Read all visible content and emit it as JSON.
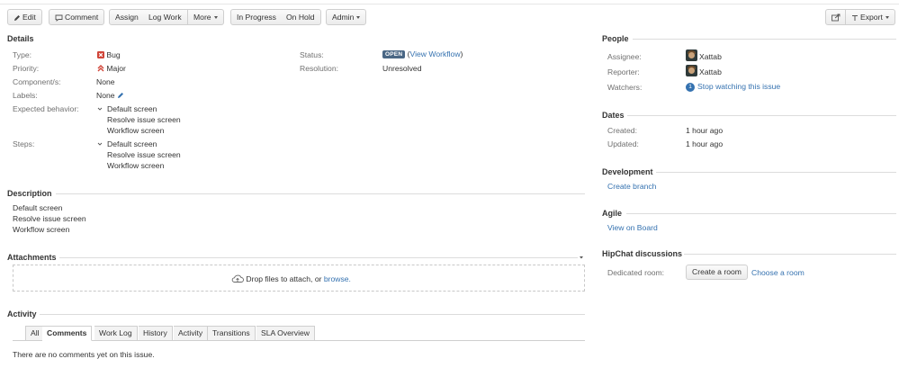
{
  "toolbar": {
    "edit": "Edit",
    "comment": "Comment",
    "assign": "Assign",
    "log_work": "Log Work",
    "more": "More",
    "in_progress": "In Progress",
    "on_hold": "On Hold",
    "admin": "Admin",
    "export": "Export"
  },
  "details": {
    "heading": "Details",
    "type_label": "Type:",
    "type_value": "Bug",
    "priority_label": "Priority:",
    "priority_value": "Major",
    "components_label": "Component/s:",
    "components_value": "None",
    "labels_label": "Labels:",
    "labels_value": "None",
    "expected_label": "Expected behavior:",
    "expected_items": [
      "Default screen",
      "Resolve issue screen",
      "Workflow screen"
    ],
    "steps_label": "Steps:",
    "steps_items": [
      "Default screen",
      "Resolve issue screen",
      "Workflow screen"
    ],
    "status_label": "Status:",
    "status_badge": "OPEN",
    "status_paren_open": "(",
    "view_workflow": "View Workflow",
    "status_paren_close": ")",
    "resolution_label": "Resolution:",
    "resolution_value": "Unresolved"
  },
  "description": {
    "heading": "Description",
    "lines": [
      "Default screen",
      "Resolve issue screen",
      "Workflow screen"
    ]
  },
  "attachments": {
    "heading": "Attachments",
    "drop_text": "Drop files to attach, or",
    "browse": "browse."
  },
  "activity": {
    "heading": "Activity",
    "tabs": [
      "All",
      "Comments",
      "Work Log",
      "History",
      "Activity",
      "Transitions",
      "SLA Overview"
    ],
    "active_tab": "Comments",
    "empty_text": "There are no comments yet on this issue."
  },
  "people": {
    "heading": "People",
    "assignee_label": "Assignee:",
    "assignee": "Xattab",
    "reporter_label": "Reporter:",
    "reporter": "Xattab",
    "watchers_label": "Watchers:",
    "watchers_count": "1",
    "watch_link": "Stop watching this issue"
  },
  "dates": {
    "heading": "Dates",
    "created_label": "Created:",
    "created": "1 hour ago",
    "updated_label": "Updated:",
    "updated": "1 hour ago"
  },
  "development": {
    "heading": "Development",
    "create_branch": "Create branch"
  },
  "agile": {
    "heading": "Agile",
    "view_on_board": "View on Board"
  },
  "hipchat": {
    "heading": "HipChat discussions",
    "room_label": "Dedicated room:",
    "create_room": "Create a room",
    "choose_room": "Choose a room"
  },
  "colors": {
    "link": "#3572b0",
    "open_badge": "#4a6785",
    "bug_red": "#d04437"
  }
}
